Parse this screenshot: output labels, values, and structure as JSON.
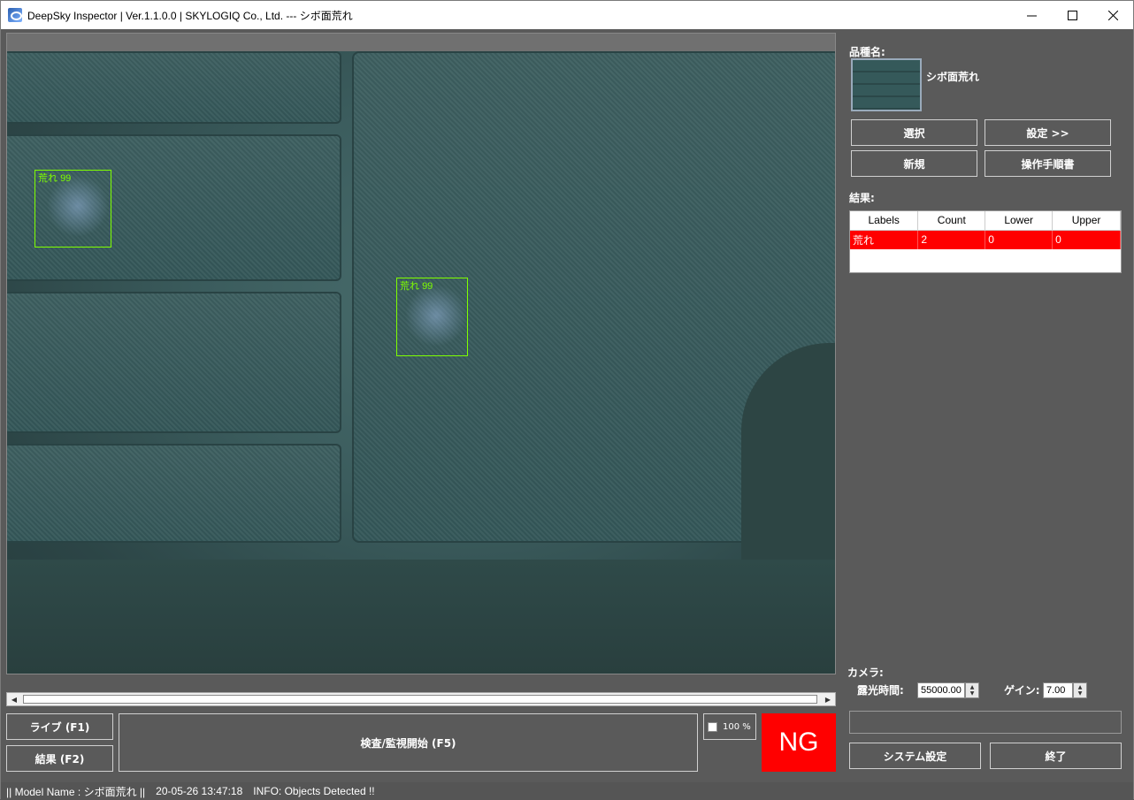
{
  "window": {
    "title": "DeepSky Inspector | Ver.1.1.0.0 | SKYLOGIQ Co., Ltd. --- シボ面荒れ",
    "minimize_label": "—",
    "maximize_label": "☐",
    "close_label": "✕"
  },
  "viewer": {
    "detections": [
      {
        "label": "荒れ",
        "score": "99"
      },
      {
        "label": "荒れ",
        "score": "99"
      }
    ]
  },
  "controls": {
    "live_button": "ライブ (F1)",
    "result_button": "結果 (F2)",
    "inspect_button": "検査/監視開始 (F5)",
    "zoom_label": "100 %",
    "verdict": "NG",
    "verdict_color": "#ff0000"
  },
  "sidebar": {
    "product_label": "品種名:",
    "product_name": "シボ面荒れ",
    "select_button": "選択",
    "settings_button": "設定 >>",
    "new_button": "新規",
    "manual_button": "操作手順書",
    "results_label": "結果:",
    "results_table": {
      "headers": [
        "Labels",
        "Count",
        "Lower",
        "Upper"
      ],
      "rows": [
        [
          "荒れ",
          "2",
          "0",
          "0"
        ]
      ]
    },
    "camera_label": "カメラ:",
    "exposure_label": "露光時間:",
    "exposure_value": "55000.00",
    "gain_label": "ゲイン:",
    "gain_value": "7.00",
    "system_settings_button": "システム設定",
    "exit_button": "終了"
  },
  "status": {
    "model": "|| Model Name : シボ面荒れ ||",
    "timestamp": "20-05-26 13:47:18",
    "info": "INFO:  Objects Detected !!"
  }
}
